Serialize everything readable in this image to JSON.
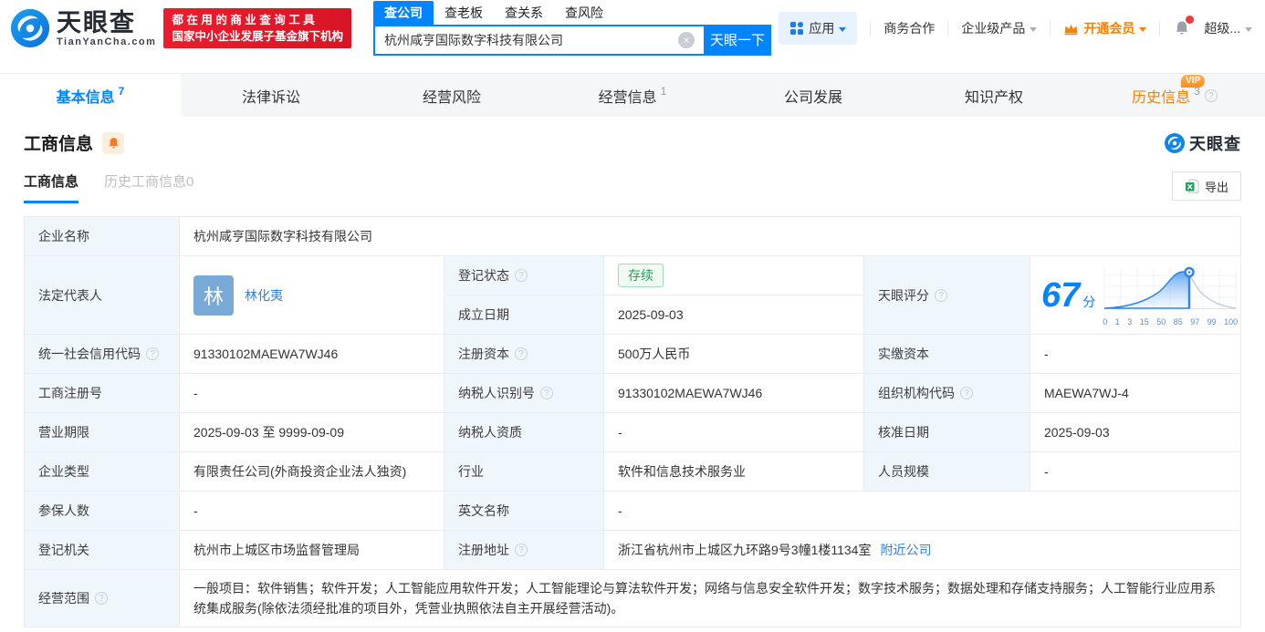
{
  "icons": {
    "help": "?",
    "clear": "×"
  },
  "header": {
    "logo": {
      "brand": "天眼查",
      "domain": "TianYanCha.com"
    },
    "slogan": {
      "line1": "都 在 用 的 商 业 查 询 工 具",
      "line2": "国家中小企业发展子基金旗下机构"
    },
    "search": {
      "tabs": [
        "查公司",
        "查老板",
        "查关系",
        "查风险"
      ],
      "value": "杭州咸亨国际数字科技有限公司",
      "button": "天眼一下"
    },
    "menu": {
      "apps": "应用",
      "cooperation": "商务合作",
      "enterprise": "企业级产品",
      "vip": "开通会员",
      "super": "超级..."
    }
  },
  "nav_tabs": [
    {
      "label": "基本信息",
      "count": "7"
    },
    {
      "label": "法律诉讼",
      "count": ""
    },
    {
      "label": "经营风险",
      "count": ""
    },
    {
      "label": "经营信息",
      "count": "1"
    },
    {
      "label": "公司发展",
      "count": ""
    },
    {
      "label": "知识产权",
      "count": ""
    },
    {
      "label": "历史信息",
      "count": "3",
      "vip_badge": "VIP"
    }
  ],
  "section": {
    "title": "工商信息",
    "watermark": "天眼查",
    "subtabs": [
      "工商信息",
      "历史工商信息0"
    ],
    "export": "导出"
  },
  "table": {
    "company_name": {
      "label": "企业名称",
      "value": "杭州咸亨国际数字科技有限公司"
    },
    "legal_rep": {
      "label": "法定代表人",
      "avatar": "林",
      "name": "林化夷"
    },
    "reg_status": {
      "label": "登记状态",
      "value": "存续"
    },
    "establish_date": {
      "label": "成立日期",
      "value": "2025-09-03"
    },
    "score": {
      "label": "天眼评分",
      "value": "67",
      "unit": "分"
    },
    "credit_code": {
      "label": "统一社会信用代码",
      "value": "91330102MAEWA7WJ46"
    },
    "reg_capital": {
      "label": "注册资本",
      "value": "500万人民币"
    },
    "paid_capital": {
      "label": "实缴资本",
      "value": "-"
    },
    "reg_number": {
      "label": "工商注册号",
      "value": "-"
    },
    "taxpayer_id": {
      "label": "纳税人识别号",
      "value": "91330102MAEWA7WJ46"
    },
    "org_code": {
      "label": "组织机构代码",
      "value": "MAEWA7WJ-4"
    },
    "business_term": {
      "label": "营业期限",
      "value": "2025-09-03 至 9999-09-09"
    },
    "taxpayer_quality": {
      "label": "纳税人资质",
      "value": "-"
    },
    "approval_date": {
      "label": "核准日期",
      "value": "2025-09-03"
    },
    "company_type": {
      "label": "企业类型",
      "value": "有限责任公司(外商投资企业法人独资)"
    },
    "industry": {
      "label": "行业",
      "value": "软件和信息技术服务业"
    },
    "staff_size": {
      "label": "人员规模",
      "value": "-"
    },
    "insured_count": {
      "label": "参保人数",
      "value": "-"
    },
    "english_name": {
      "label": "英文名称",
      "value": "-"
    },
    "reg_authority": {
      "label": "登记机关",
      "value": "杭州市上城区市场监督管理局"
    },
    "reg_address": {
      "label": "注册地址",
      "value": "浙江省杭州市上城区九环路9号3幢1楼1134室",
      "link": "附近公司"
    },
    "business_scope": {
      "label": "经营范围",
      "value": "一般项目：软件销售；软件开发；人工智能应用软件开发；人工智能理论与算法软件开发；网络与信息安全软件开发；数字技术服务；数据处理和存储支持服务；人工智能行业应用系统集成服务(除依法须经批准的项目外，凭营业执照依法自主开展经营活动)。"
    }
  },
  "chart_data": {
    "type": "area",
    "title": "天眼评分",
    "score": 67,
    "x_ticks": [
      "0",
      "1",
      "3",
      "15",
      "50",
      "85",
      "97",
      "99",
      "100"
    ],
    "marker_at": 67,
    "legend_position": "none",
    "grid": true
  },
  "colors": {
    "brand_blue": "#0084ff",
    "link_blue": "#2f82d9",
    "promo_red": "#e01524",
    "vip_orange": "#ff8000",
    "status_green": "#21a35a",
    "label_bg": "#eff6fc"
  }
}
